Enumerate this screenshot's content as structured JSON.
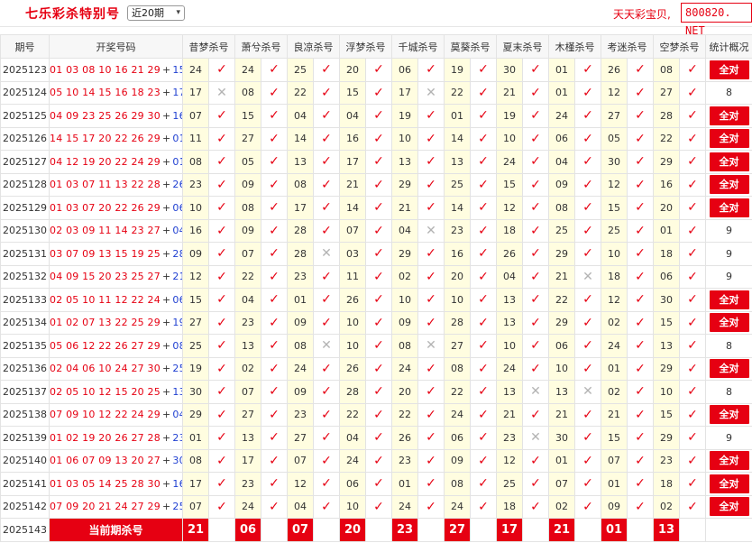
{
  "header": {
    "title": "七乐彩杀特别号",
    "period_select": "近20期",
    "brand_text": "天天彩宝贝,",
    "site_text": "800820. NET"
  },
  "colors": {
    "accent": "#e60012",
    "special_number": "#1f3fd1",
    "kill_cell_bg": "#fffde0"
  },
  "columns": {
    "issue": "期号",
    "draw": "开奖号码",
    "experts": [
      "昔梦杀号",
      "萧兮杀号",
      "良凉杀号",
      "浮梦杀号",
      "千城杀号",
      "莫葵杀号",
      "夏末杀号",
      "木槿杀号",
      "考迷杀号",
      "空梦杀号"
    ],
    "stats": "统计概况"
  },
  "rows": [
    {
      "issue": "2025123",
      "main": "01 03 08 10 16 21 29",
      "special": "15",
      "picks": [
        "24",
        "24",
        "25",
        "20",
        "06",
        "19",
        "30",
        "01",
        "26",
        "08"
      ],
      "marks": [
        1,
        1,
        1,
        1,
        1,
        1,
        1,
        1,
        1,
        1
      ],
      "stat": "全对"
    },
    {
      "issue": "2025124",
      "main": "05 10 14 15 16 18 23",
      "special": "17",
      "picks": [
        "17",
        "08",
        "22",
        "15",
        "17",
        "22",
        "21",
        "01",
        "12",
        "27"
      ],
      "marks": [
        0,
        1,
        1,
        1,
        0,
        1,
        1,
        1,
        1,
        1
      ],
      "stat": "8"
    },
    {
      "issue": "2025125",
      "main": "04 09 23 25 26 29 30",
      "special": "16",
      "picks": [
        "07",
        "15",
        "04",
        "04",
        "19",
        "01",
        "19",
        "24",
        "27",
        "28"
      ],
      "marks": [
        1,
        1,
        1,
        1,
        1,
        1,
        1,
        1,
        1,
        1
      ],
      "stat": "全对"
    },
    {
      "issue": "2025126",
      "main": "14 15 17 20 22 26 29",
      "special": "01",
      "picks": [
        "11",
        "27",
        "14",
        "16",
        "10",
        "14",
        "10",
        "06",
        "05",
        "22"
      ],
      "marks": [
        1,
        1,
        1,
        1,
        1,
        1,
        1,
        1,
        1,
        1
      ],
      "stat": "全对"
    },
    {
      "issue": "2025127",
      "main": "04 12 19 20 22 24 29",
      "special": "01",
      "picks": [
        "08",
        "05",
        "13",
        "17",
        "13",
        "13",
        "24",
        "04",
        "30",
        "29"
      ],
      "marks": [
        1,
        1,
        1,
        1,
        1,
        1,
        1,
        1,
        1,
        1
      ],
      "stat": "全对"
    },
    {
      "issue": "2025128",
      "main": "01 03 07 11 13 22 28",
      "special": "26",
      "picks": [
        "23",
        "09",
        "08",
        "21",
        "29",
        "25",
        "15",
        "09",
        "12",
        "16"
      ],
      "marks": [
        1,
        1,
        1,
        1,
        1,
        1,
        1,
        1,
        1,
        1
      ],
      "stat": "全对"
    },
    {
      "issue": "2025129",
      "main": "01 03 07 20 22 26 29",
      "special": "06",
      "picks": [
        "10",
        "08",
        "17",
        "14",
        "21",
        "14",
        "12",
        "08",
        "15",
        "20"
      ],
      "marks": [
        1,
        1,
        1,
        1,
        1,
        1,
        1,
        1,
        1,
        1
      ],
      "stat": "全对"
    },
    {
      "issue": "2025130",
      "main": "02 03 09 11 14 23 27",
      "special": "04",
      "picks": [
        "16",
        "09",
        "28",
        "07",
        "04",
        "23",
        "18",
        "25",
        "25",
        "01"
      ],
      "marks": [
        1,
        1,
        1,
        1,
        0,
        1,
        1,
        1,
        1,
        1
      ],
      "stat": "9"
    },
    {
      "issue": "2025131",
      "main": "03 07 09 13 15 19 25",
      "special": "28",
      "picks": [
        "09",
        "07",
        "28",
        "03",
        "29",
        "16",
        "26",
        "29",
        "10",
        "18"
      ],
      "marks": [
        1,
        1,
        0,
        1,
        1,
        1,
        1,
        1,
        1,
        1
      ],
      "stat": "9"
    },
    {
      "issue": "2025132",
      "main": "04 09 15 20 23 25 27",
      "special": "21",
      "picks": [
        "12",
        "22",
        "23",
        "11",
        "02",
        "20",
        "04",
        "21",
        "18",
        "06"
      ],
      "marks": [
        1,
        1,
        1,
        1,
        1,
        1,
        1,
        0,
        1,
        1
      ],
      "stat": "9"
    },
    {
      "issue": "2025133",
      "main": "02 05 10 11 12 22 24",
      "special": "06",
      "picks": [
        "15",
        "04",
        "01",
        "26",
        "10",
        "10",
        "13",
        "22",
        "12",
        "30"
      ],
      "marks": [
        1,
        1,
        1,
        1,
        1,
        1,
        1,
        1,
        1,
        1
      ],
      "stat": "全对"
    },
    {
      "issue": "2025134",
      "main": "01 02 07 13 22 25 29",
      "special": "19",
      "picks": [
        "27",
        "23",
        "09",
        "10",
        "09",
        "28",
        "13",
        "29",
        "02",
        "15"
      ],
      "marks": [
        1,
        1,
        1,
        1,
        1,
        1,
        1,
        1,
        1,
        1
      ],
      "stat": "全对"
    },
    {
      "issue": "2025135",
      "main": "05 06 12 22 26 27 29",
      "special": "08",
      "picks": [
        "25",
        "13",
        "08",
        "10",
        "08",
        "27",
        "10",
        "06",
        "24",
        "13"
      ],
      "marks": [
        1,
        1,
        0,
        1,
        0,
        1,
        1,
        1,
        1,
        1
      ],
      "stat": "8"
    },
    {
      "issue": "2025136",
      "main": "02 04 06 10 24 27 30",
      "special": "25",
      "picks": [
        "19",
        "02",
        "24",
        "26",
        "24",
        "08",
        "24",
        "10",
        "01",
        "29"
      ],
      "marks": [
        1,
        1,
        1,
        1,
        1,
        1,
        1,
        1,
        1,
        1
      ],
      "stat": "全对"
    },
    {
      "issue": "2025137",
      "main": "02 05 10 12 15 20 25",
      "special": "13",
      "picks": [
        "30",
        "07",
        "09",
        "28",
        "20",
        "22",
        "13",
        "13",
        "02",
        "10"
      ],
      "marks": [
        1,
        1,
        1,
        1,
        1,
        1,
        0,
        0,
        1,
        1
      ],
      "stat": "8"
    },
    {
      "issue": "2025138",
      "main": "07 09 10 12 22 24 29",
      "special": "04",
      "picks": [
        "29",
        "27",
        "23",
        "22",
        "22",
        "24",
        "21",
        "21",
        "21",
        "15"
      ],
      "marks": [
        1,
        1,
        1,
        1,
        1,
        1,
        1,
        1,
        1,
        1
      ],
      "stat": "全对"
    },
    {
      "issue": "2025139",
      "main": "01 02 19 20 26 27 28",
      "special": "23",
      "picks": [
        "01",
        "13",
        "27",
        "04",
        "26",
        "06",
        "23",
        "30",
        "15",
        "29"
      ],
      "marks": [
        1,
        1,
        1,
        1,
        1,
        1,
        0,
        1,
        1,
        1
      ],
      "stat": "9"
    },
    {
      "issue": "2025140",
      "main": "01 06 07 09 13 20 27",
      "special": "30",
      "picks": [
        "08",
        "17",
        "07",
        "24",
        "23",
        "09",
        "12",
        "01",
        "07",
        "23"
      ],
      "marks": [
        1,
        1,
        1,
        1,
        1,
        1,
        1,
        1,
        1,
        1
      ],
      "stat": "全对"
    },
    {
      "issue": "2025141",
      "main": "01 03 05 14 25 28 30",
      "special": "16",
      "picks": [
        "17",
        "23",
        "12",
        "06",
        "01",
        "08",
        "25",
        "07",
        "01",
        "18"
      ],
      "marks": [
        1,
        1,
        1,
        1,
        1,
        1,
        1,
        1,
        1,
        1
      ],
      "stat": "全对"
    },
    {
      "issue": "2025142",
      "main": "07 09 20 21 24 27 29",
      "special": "25",
      "picks": [
        "07",
        "24",
        "04",
        "10",
        "24",
        "24",
        "18",
        "02",
        "09",
        "02"
      ],
      "marks": [
        1,
        1,
        1,
        1,
        1,
        1,
        1,
        1,
        1,
        1
      ],
      "stat": "全对"
    }
  ],
  "current": {
    "issue": "2025143",
    "label": "当前期杀号",
    "picks": [
      "21",
      "06",
      "07",
      "20",
      "23",
      "27",
      "17",
      "21",
      "01",
      "13"
    ]
  },
  "glyphs": {
    "ok": "✓",
    "bad": "✕",
    "plus": "+"
  }
}
